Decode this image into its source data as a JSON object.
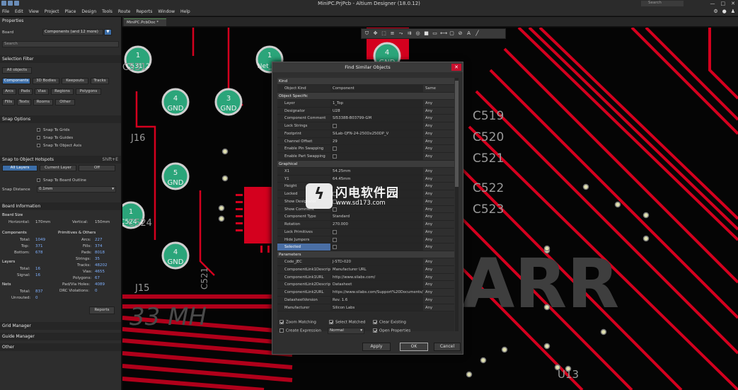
{
  "app": {
    "title": "MiniPC.PrjPcb - Altium Designer (18.0.12)",
    "search_placeholder": "Search",
    "window_buttons": [
      "—",
      "□",
      "✕"
    ]
  },
  "menu": [
    "File",
    "Edit",
    "View",
    "Project",
    "Place",
    "Design",
    "Tools",
    "Route",
    "Reports",
    "Window",
    "Help"
  ],
  "properties": {
    "header": "Properties",
    "board_label": "Board",
    "board_dropdown": "Components (and 12 more)",
    "search_placeholder": "Search",
    "selection_filter": {
      "title": "Selection Filter",
      "all_objects": "All objects",
      "buttons": [
        "Components",
        "3D Bodies",
        "Keepouts",
        "Tracks",
        "Arcs",
        "Pads",
        "Vias",
        "Regions",
        "Polygons",
        "Fills",
        "Texts",
        "Rooms",
        "Other"
      ]
    },
    "snap_options": {
      "title": "Snap Options",
      "items": [
        "Snap To Grids",
        "Snap To Guides",
        "Snap To Object Axis"
      ]
    },
    "hotspots": {
      "title": "Snap to Object Hotspots",
      "shortcut": "Shift+E",
      "buttons": [
        "All Layers",
        "Current Layer",
        "Off"
      ],
      "board_outline": "Snap To Board Outline",
      "distance_label": "Snap Distance",
      "distance_value": "0.1mm"
    },
    "board_info": {
      "title": "Board Information",
      "board_size": "Board Size",
      "horizontal_label": "Horizontal:",
      "horizontal_value": "170mm",
      "vertical_label": "Vertical:",
      "vertical_value": "150mm",
      "components_title": "Components",
      "components": [
        [
          "Total:",
          "1049"
        ],
        [
          "Top:",
          "371"
        ],
        [
          "Bottom:",
          "678"
        ]
      ],
      "primitives_title": "Primitives & Others",
      "primitives": [
        [
          "Arcs:",
          "227"
        ],
        [
          "Fills:",
          "374"
        ],
        [
          "Pads:",
          "8018"
        ],
        [
          "Strings:",
          "35"
        ],
        [
          "Tracks:",
          "48202"
        ],
        [
          "Vias:",
          "4655"
        ],
        [
          "Polygons:",
          "67"
        ],
        [
          "Pad/Via Holes:",
          "4089"
        ],
        [
          "DRC Violations:",
          "0"
        ]
      ],
      "layers_title": "Layers",
      "layers": [
        [
          "Total:",
          "16"
        ],
        [
          "Signal:",
          "16"
        ]
      ],
      "nets_title": "Nets",
      "nets": [
        [
          "Total:",
          "837"
        ],
        [
          "Unrouted:",
          "0"
        ]
      ],
      "reports_button": "Reports"
    },
    "grid_manager": "Grid Manager",
    "guide_manager": "Guide Manager",
    "other": "Other"
  },
  "doc_tab": "MiniPC.PcbDoc *",
  "canvas": {
    "designator_labels": [
      "C531",
      "J16",
      "J15",
      "C524",
      "C521",
      "C519",
      "C520",
      "C521",
      "C522",
      "C523",
      "U13"
    ],
    "pad_labels": [
      [
        "1",
        "C531_2"
      ],
      [
        "1",
        "Net_J16"
      ],
      [
        "4",
        "GND"
      ],
      [
        "3",
        "GND"
      ],
      [
        "5",
        "GND"
      ],
      [
        "1",
        "C524_2"
      ],
      [
        "4",
        "GND"
      ],
      [
        "4",
        "GND"
      ]
    ],
    "silkscreen": [
      "33 MH",
      "ARR"
    ]
  },
  "dialog": {
    "title": "Find Similar Objects",
    "sections": [
      {
        "name": "Kind",
        "rows": [
          [
            "Object Kind",
            "Component",
            "Same"
          ]
        ]
      },
      {
        "name": "Object Specific",
        "rows": [
          [
            "Layer",
            "1_Top",
            "Any"
          ],
          [
            "Designator",
            "U28",
            "Any"
          ],
          [
            "Component Comment",
            "SI5338B-B03799-GM",
            "Any"
          ],
          [
            "Lock Strings",
            "",
            "Any"
          ],
          [
            "Footprint",
            "SiLab-QFN-24-250Dx250DP_V",
            "Any"
          ],
          [
            "Channel Offset",
            "29",
            "Any"
          ],
          [
            "Enable Pin Swapping",
            "",
            "Any"
          ],
          [
            "Enable Part Swapping",
            "",
            "Any"
          ]
        ]
      },
      {
        "name": "Graphical",
        "rows": [
          [
            "X1",
            "54.25mm",
            "Any"
          ],
          [
            "Y1",
            "64.45mm",
            "Any"
          ],
          [
            "Height",
            "",
            "Any"
          ],
          [
            "Locked",
            "",
            "Any"
          ],
          [
            "Show Designator",
            "",
            "Any"
          ],
          [
            "Show Comment",
            "",
            "Any"
          ],
          [
            "Component Type",
            "Standard",
            "Any"
          ],
          [
            "Rotation",
            "270.000",
            "Any"
          ],
          [
            "Lock Primitives",
            "",
            "Any"
          ],
          [
            "Hide Jumpers",
            "",
            "Any"
          ],
          [
            "Selected",
            "",
            "Any"
          ]
        ]
      },
      {
        "name": "Parameters",
        "rows": [
          [
            "Code_JEC",
            "J-STD-020",
            "Any"
          ],
          [
            "ComponentLink1Description",
            "Manufacturer URL",
            "Any"
          ],
          [
            "ComponentLink1URL",
            "http://www.silabs.com/",
            "Any"
          ],
          [
            "ComponentLink2Description",
            "Datasheet",
            "Any"
          ],
          [
            "ComponentLink2URL",
            "https://www.silabs.com/Support%20Documents/...",
            "Any"
          ],
          [
            "DatasheetVersion",
            "Rev. 1.6",
            "Any"
          ],
          [
            "Manufacturer",
            "Silicon Labs",
            "Any"
          ]
        ]
      }
    ],
    "options": {
      "zoom_matching": "Zoom Matching",
      "select_matched": "Select Matched",
      "clear_existing": "Clear Existing",
      "create_expression": "Create Expression",
      "mask_mode": "Normal",
      "open_properties": "Open Properties"
    },
    "buttons": {
      "apply": "Apply",
      "ok": "OK",
      "cancel": "Cancel"
    }
  },
  "watermark": {
    "line1": "闪电软件园",
    "line2": "www.sd173.com"
  },
  "colors": {
    "accent": "#3c6ea8",
    "track": "#d4001e",
    "pad": "#2ba57a",
    "close": "#c8102e"
  }
}
